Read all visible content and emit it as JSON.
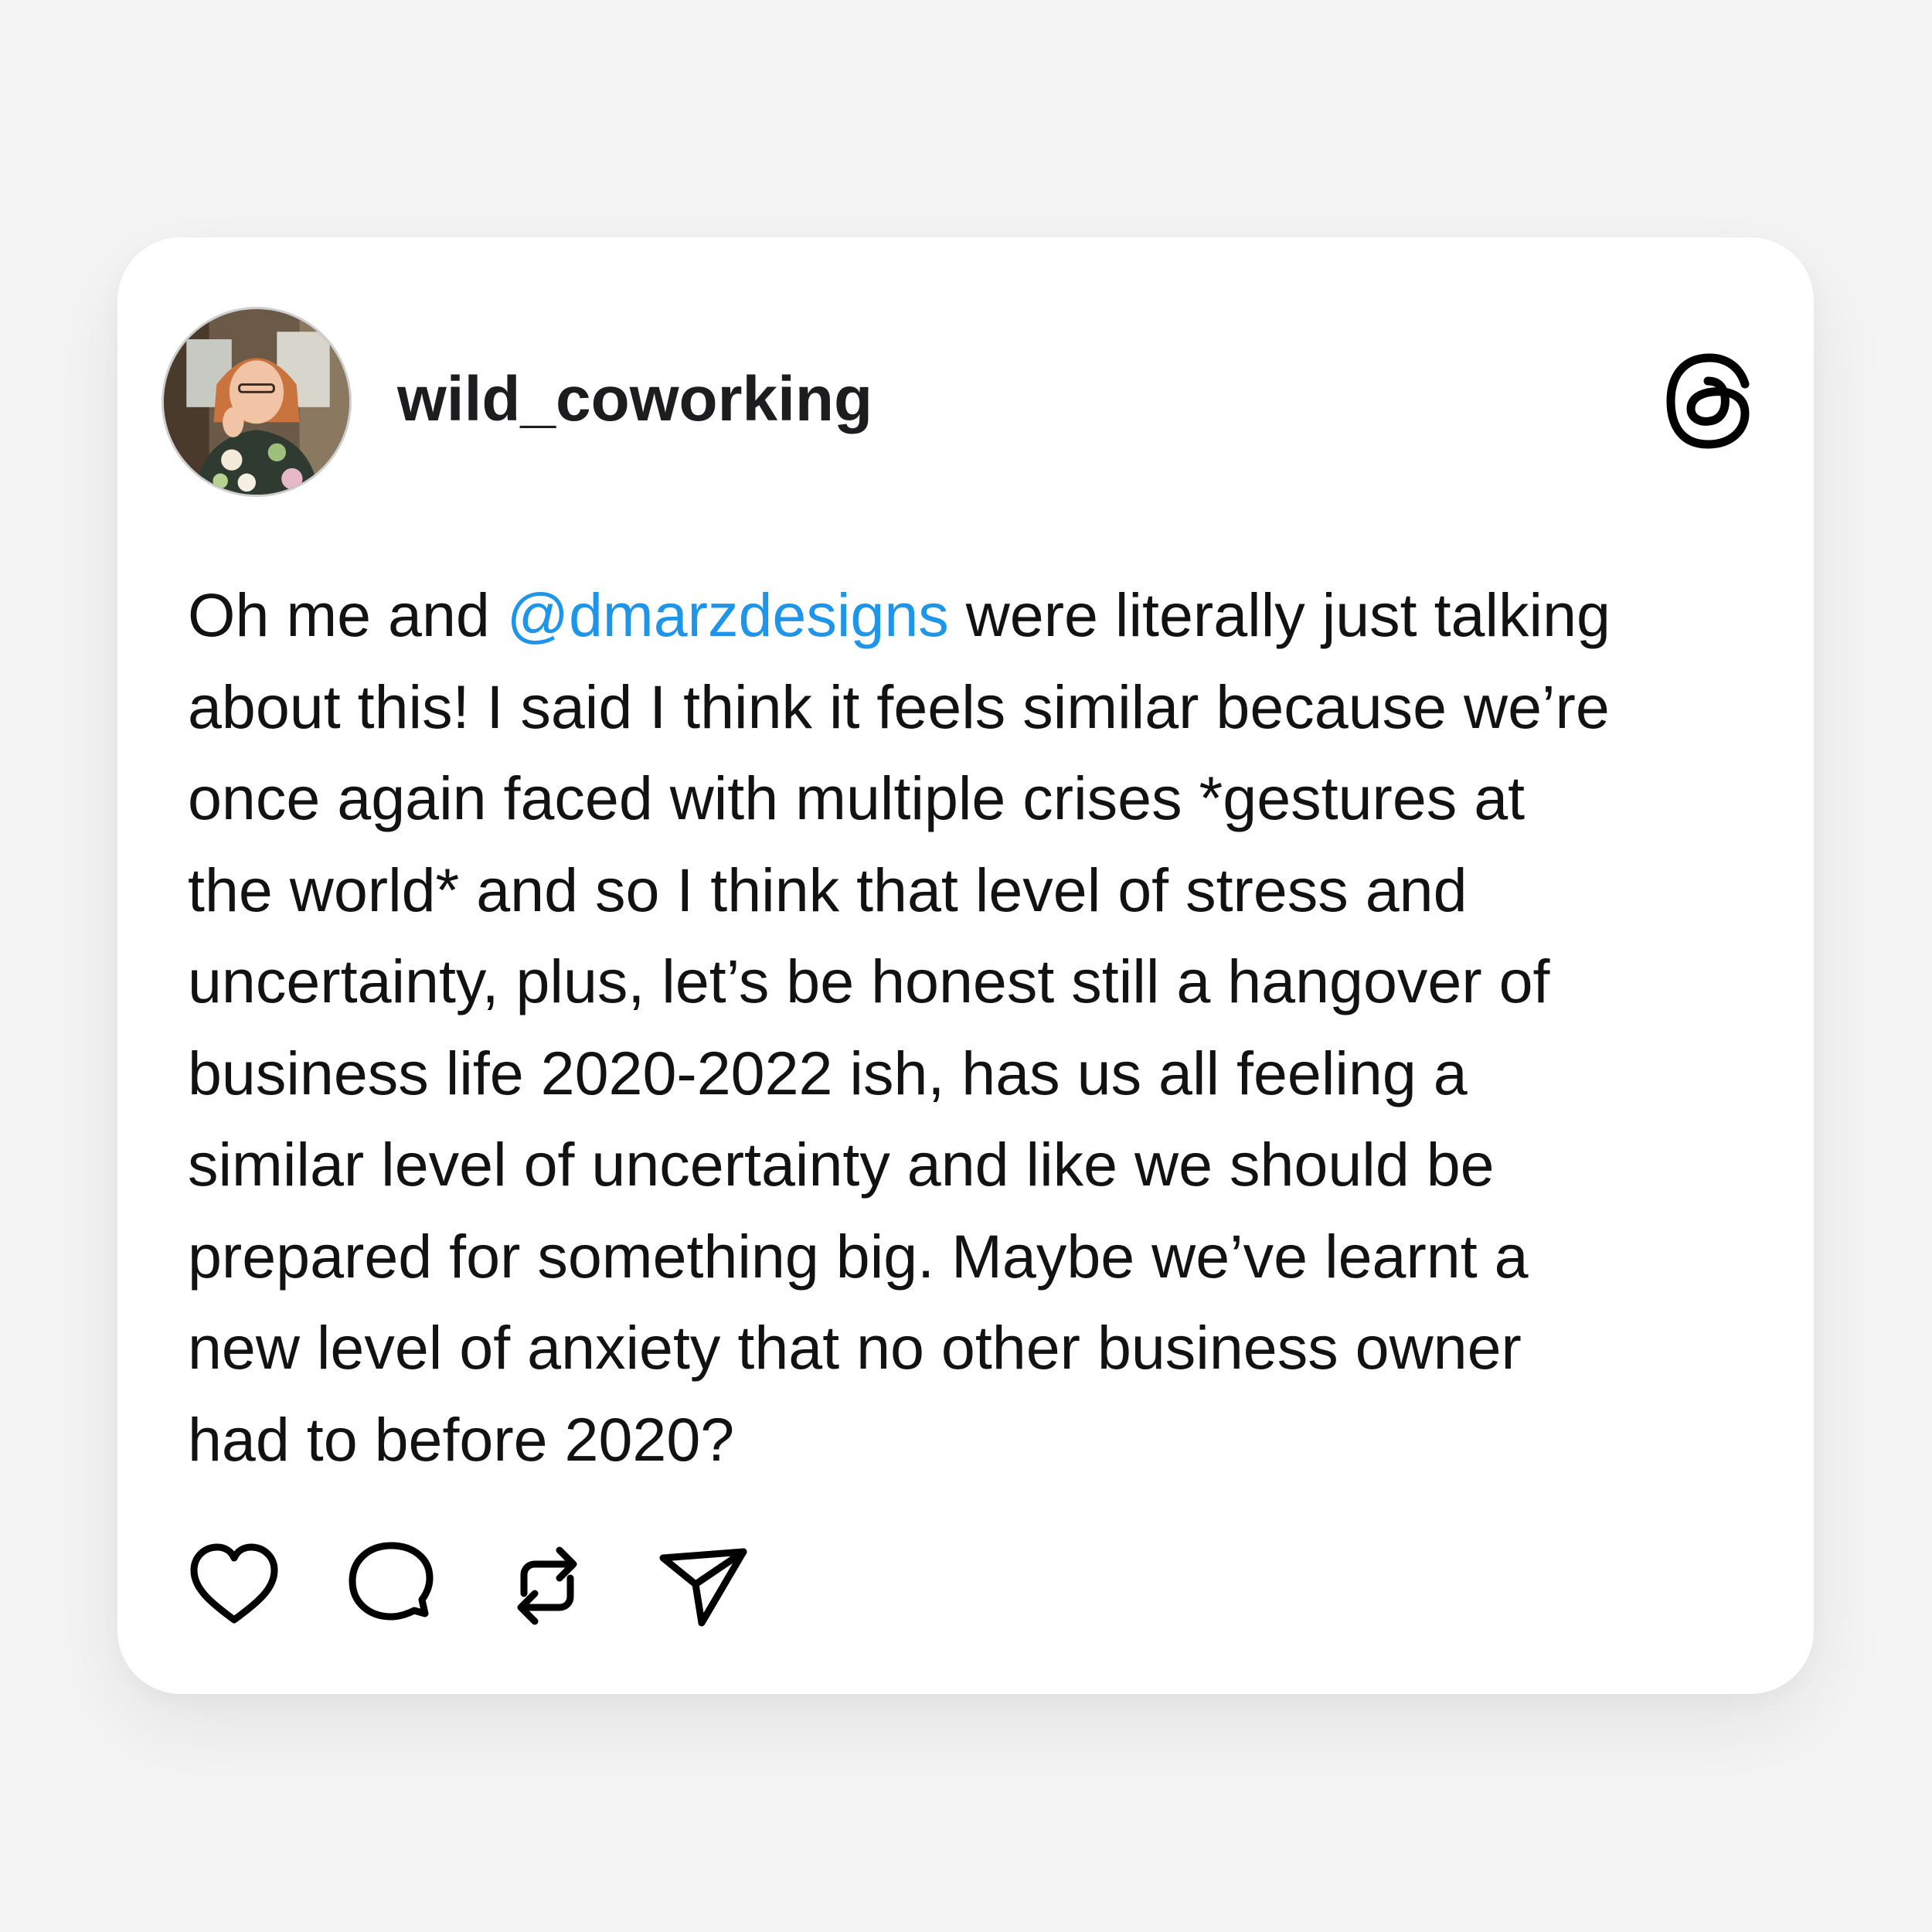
{
  "post": {
    "username": "wild_coworking",
    "lines": [
      {
        "before": "Oh me and ",
        "mention": "@dmarzdesigns",
        "after": " were literally just talking"
      },
      {
        "text": "about this! I said I think it feels similar because we’re"
      },
      {
        "text": "once again faced with multiple crises *gestures at"
      },
      {
        "text": "the world* and so I think that level of stress and"
      },
      {
        "text": "uncertainty, plus, let’s be honest still a hangover of"
      },
      {
        "text": "business life 2020-2022 ish, has us all feeling a"
      },
      {
        "text": "similar level of uncertainty and like we should be"
      },
      {
        "text": "prepared for something big. Maybe we’ve learnt a"
      },
      {
        "text": "new level of anxiety that no other business owner"
      },
      {
        "text": "had to before 2020?"
      }
    ]
  },
  "icons": {
    "avatar": "profile-photo",
    "brand": "threads-logo-icon",
    "actions": [
      "heart-icon",
      "comment-icon",
      "repost-icon",
      "share-icon"
    ]
  },
  "colors": {
    "background": "#f4f4f4",
    "card": "#ffffff",
    "text": "#121212",
    "mention": "#1f95ea"
  }
}
